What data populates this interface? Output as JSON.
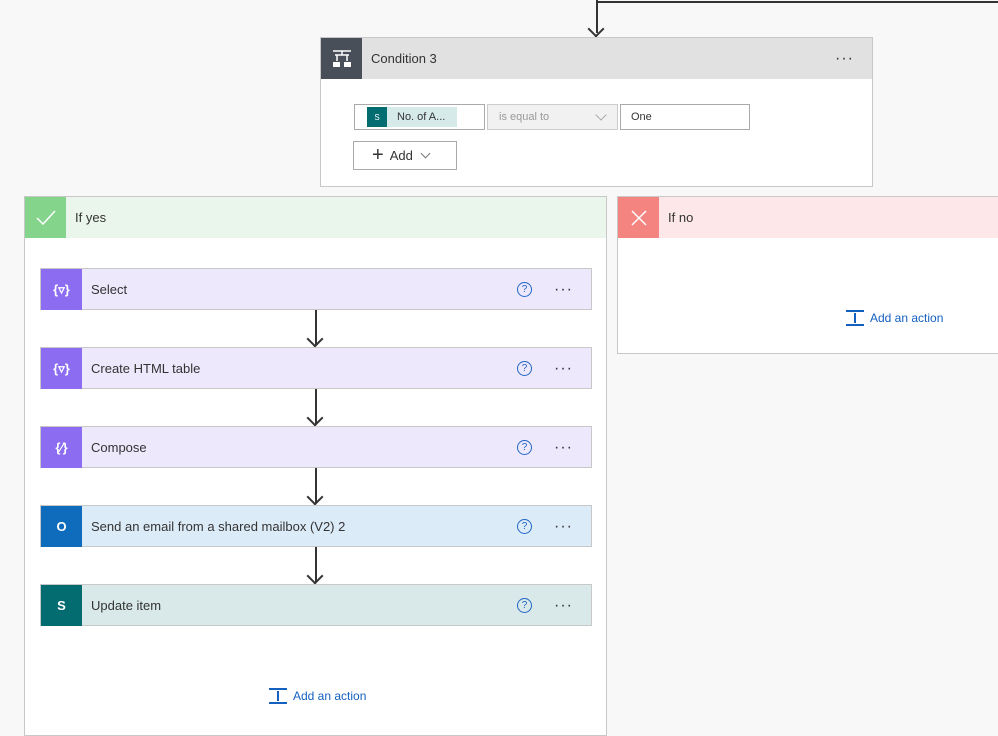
{
  "condition": {
    "title": "Condition 3",
    "more": "···",
    "token_label": "No. of A...",
    "operator": "is equal to",
    "value": "One",
    "add_label": "Add"
  },
  "yes_branch": {
    "title": "If yes",
    "color": "#84d48c",
    "actions": [
      {
        "label": "Select",
        "icon": "data-operation-icon",
        "color": "#8c6cf0",
        "bg": "#ede8fc"
      },
      {
        "label": "Create HTML table",
        "icon": "data-operation-icon",
        "color": "#8c6cf0",
        "bg": "#ede8fc"
      },
      {
        "label": "Compose",
        "icon": "compose-icon",
        "color": "#8c6cf0",
        "bg": "#ede8fc"
      },
      {
        "label": "Send an email from a shared mailbox (V2) 2",
        "icon": "outlook-icon",
        "color": "#0f6cbd",
        "bg": "#dcebf8"
      },
      {
        "label": "Update item",
        "icon": "sharepoint-icon",
        "color": "#036c70",
        "bg": "#d9e9e9"
      }
    ],
    "add_action": "Add an action"
  },
  "no_branch": {
    "title": "If no",
    "color": "#f3847f",
    "add_action": "Add an action"
  },
  "help_glyph": "?",
  "more_glyph": "···"
}
